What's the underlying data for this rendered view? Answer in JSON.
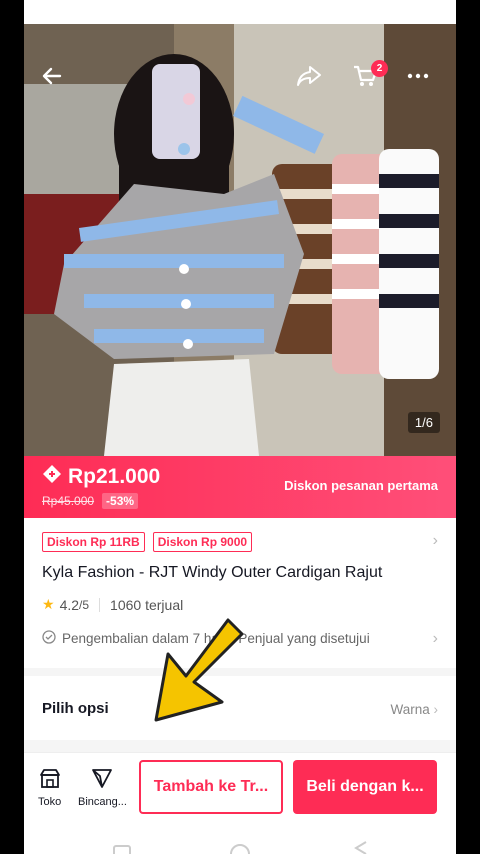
{
  "header": {
    "cart_badge": "2"
  },
  "gallery": {
    "counter": "1/6"
  },
  "price": {
    "current": "Rp21.000",
    "original": "Rp45.000",
    "discount": "-53%",
    "promo": "Diskon pesanan pertama"
  },
  "vouchers": [
    "Diskon Rp 11RB",
    "Diskon Rp 9000"
  ],
  "product": {
    "title": "Kyla Fashion - RJT Windy Outer Cardigan Rajut",
    "rating": "4.2",
    "rating_max": "/5",
    "sold": "1060 terjual",
    "policy": "Pengembalian dalam 7 hari · Penjual yang disetujui"
  },
  "options": {
    "label": "Pilih opsi",
    "value": "Warna"
  },
  "bottom": {
    "shop_label": "Toko",
    "chat_label": "Bincang...",
    "add_cart_label": "Tambah ke Tr...",
    "buy_label": "Beli dengan k..."
  },
  "colors": {
    "accent": "#fe2c55",
    "annotation_arrow": "#f5c400"
  }
}
